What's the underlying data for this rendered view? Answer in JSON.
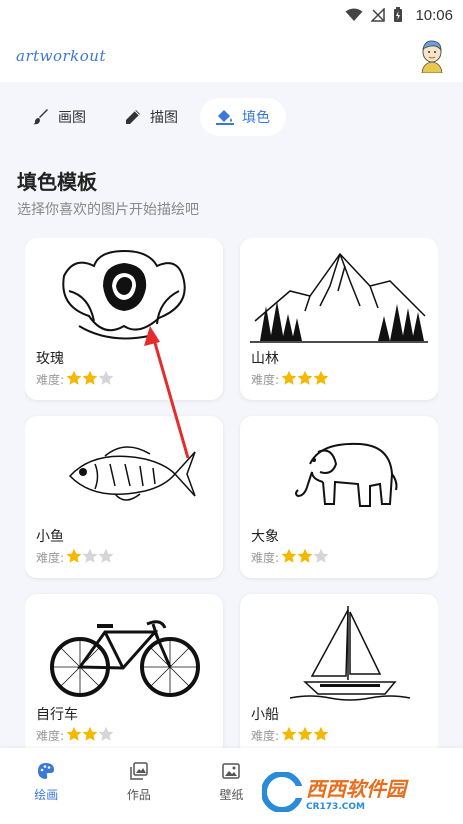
{
  "status": {
    "time": "10:06"
  },
  "app": {
    "logo": "artworkout"
  },
  "tabs": [
    {
      "label": "画图",
      "icon": "brush-icon",
      "active": false
    },
    {
      "label": "描图",
      "icon": "pencil-icon",
      "active": false
    },
    {
      "label": "填色",
      "icon": "paint-bucket-icon",
      "active": true
    }
  ],
  "section": {
    "title": "填色模板",
    "subtitle": "选择你喜欢的图片开始描绘吧"
  },
  "difficulty_label": "难度:",
  "templates": [
    {
      "name": "玫瑰",
      "stars": 2,
      "image": "rose-drawing"
    },
    {
      "name": "山林",
      "stars": 3,
      "image": "mountain-forest-drawing"
    },
    {
      "name": "小鱼",
      "stars": 1,
      "image": "fish-drawing"
    },
    {
      "name": "大象",
      "stars": 2,
      "image": "elephant-drawing"
    },
    {
      "name": "自行车",
      "stars": 2,
      "image": "bicycle-drawing"
    },
    {
      "name": "小船",
      "stars": 3,
      "image": "sailboat-drawing"
    }
  ],
  "nav": [
    {
      "label": "绘画",
      "icon": "palette-icon",
      "active": true
    },
    {
      "label": "作品",
      "icon": "gallery-icon",
      "active": false
    },
    {
      "label": "壁纸",
      "icon": "image-icon",
      "active": false
    }
  ],
  "watermark": {
    "text": "西西软件园",
    "sub": "CR173.COM"
  },
  "colors": {
    "accent": "#3b78d8",
    "star": "#f5b800",
    "star_empty": "#d6d6d6"
  }
}
